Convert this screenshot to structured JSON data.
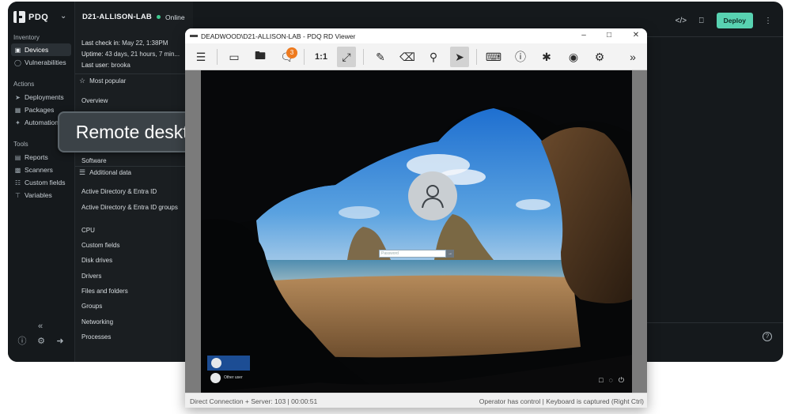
{
  "app": {
    "brand": "PDQ",
    "sidebar": {
      "sections": [
        {
          "heading": "Inventory",
          "items": [
            {
              "label": "Devices",
              "icon": "monitor-icon",
              "active": true
            },
            {
              "label": "Vulnerabilities",
              "icon": "shield-icon",
              "active": false
            }
          ]
        },
        {
          "heading": "Actions",
          "items": [
            {
              "label": "Deployments",
              "icon": "rocket-icon",
              "active": false
            },
            {
              "label": "Packages",
              "icon": "package-icon",
              "active": false
            },
            {
              "label": "Automation",
              "icon": "automation-icon",
              "active": false
            }
          ]
        },
        {
          "heading": "Tools",
          "items": [
            {
              "label": "Reports",
              "icon": "reports-icon",
              "active": false
            },
            {
              "label": "Scanners",
              "icon": "scanner-icon",
              "active": false
            },
            {
              "label": "Custom fields",
              "icon": "custom-fields-icon",
              "active": false
            },
            {
              "label": "Variables",
              "icon": "variables-icon",
              "active": false
            }
          ]
        }
      ]
    },
    "device": {
      "name": "D21-ALLISON-LAB",
      "status": "Online",
      "status_color": "#3fc98f",
      "last_checkin_label": "Last check in:",
      "last_checkin_value": "May 22, 1:38PM",
      "uptime_label": "Uptime:",
      "uptime_value": "43 days, 21 hours, 7 min...",
      "last_user_label": "Last user:",
      "last_user_value": "brooka",
      "most_popular": "Most popular",
      "overview": "Overview",
      "software": "Software",
      "additional_data": "Additional data",
      "links": [
        "Active Directory & Entra ID",
        "Active Directory & Entra ID groups",
        "CPU",
        "Custom fields",
        "Disk drives",
        "Drivers",
        "Files and folders",
        "Groups",
        "Networking",
        "Processes"
      ]
    },
    "deploy_label": "Deploy",
    "accent_color": "#58d2b1",
    "callout": "Remote desktop"
  },
  "rd": {
    "title": "DEADWOOD\\D21-ALLISON-LAB - PDQ RD Viewer",
    "chat_badge": "3",
    "ratio_label": "1:1",
    "password_placeholder": "Password",
    "other_user": "Other user",
    "status_left": "Direct Connection + Server: 103 | 00:00:51",
    "status_right": "Operator has control | Keyboard is captured (Right Ctrl)"
  }
}
